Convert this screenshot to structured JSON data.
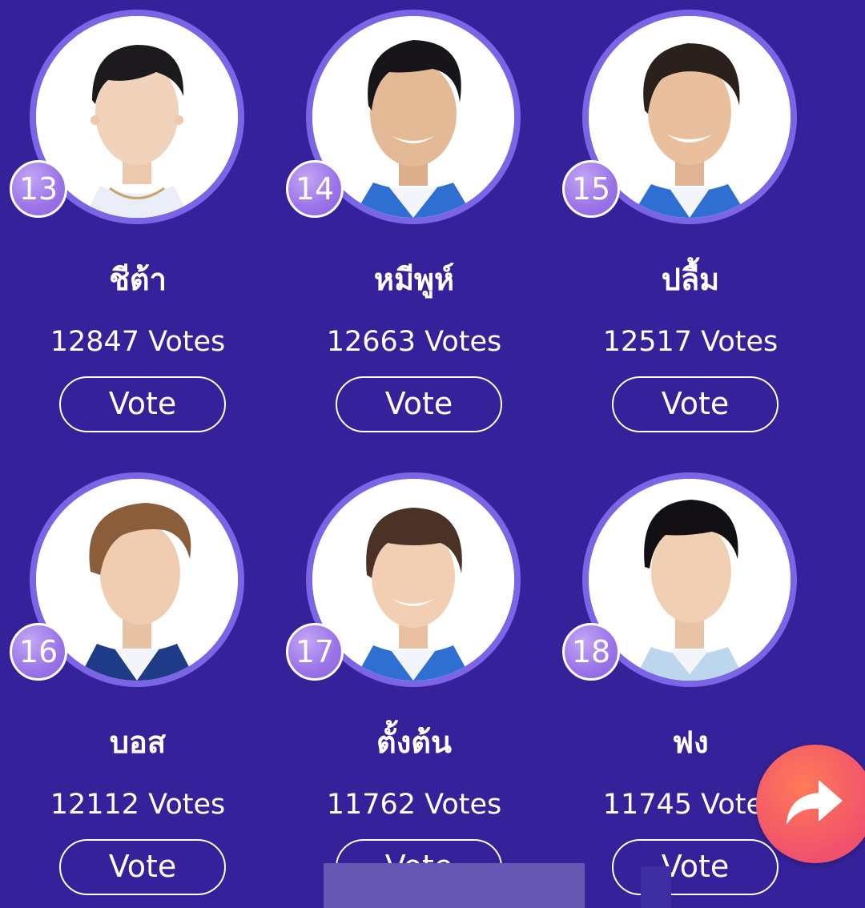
{
  "colors": {
    "background": "#35229a",
    "ring": "#7b64e6",
    "badge": "#9a73e8",
    "share_button": "#f0516b"
  },
  "vote_button_label": "Vote",
  "contestants": [
    {
      "number": "13",
      "name": "ชีต้า",
      "votes": "12847 Votes"
    },
    {
      "number": "14",
      "name": "หมีพูห์",
      "votes": "12663 Votes"
    },
    {
      "number": "15",
      "name": "ปลื้ม",
      "votes": "12517 Votes"
    },
    {
      "number": "16",
      "name": "บอส",
      "votes": "12112 Votes"
    },
    {
      "number": "17",
      "name": "ตั้งต้น",
      "votes": "11762 Votes"
    },
    {
      "number": "18",
      "name": "ฟง",
      "votes": "11745 Votes"
    }
  ],
  "share_icon": "share-arrow-icon"
}
